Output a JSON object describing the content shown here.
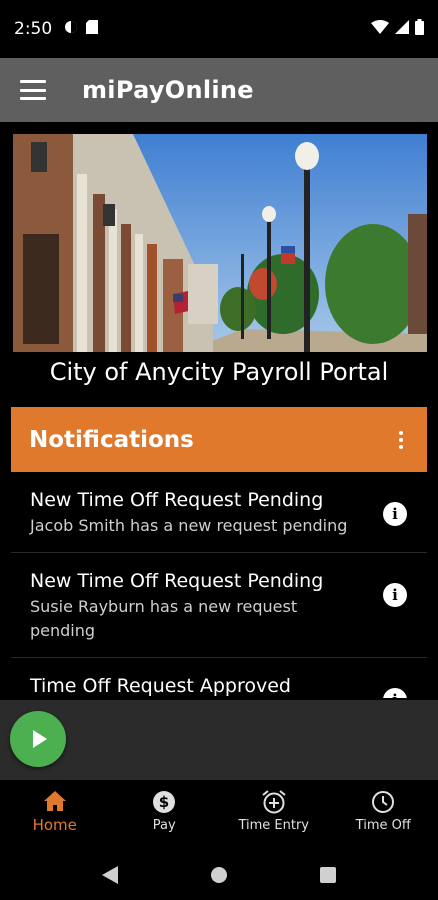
{
  "status_bar": {
    "time": "2:50"
  },
  "app_bar": {
    "title": "miPayOnline"
  },
  "portal": {
    "title": "City of Anycity Payroll Portal"
  },
  "notifications": {
    "header": "Notifications",
    "items": [
      {
        "title": "New Time Off Request Pending",
        "body": "Jacob Smith has a new request pending"
      },
      {
        "title": "New Time Off Request Pending",
        "body": "Susie Rayburn has a new request pending"
      },
      {
        "title": "Time Off Request Approved",
        "body": ""
      }
    ]
  },
  "bottom_nav": {
    "items": [
      {
        "label": "Home",
        "icon": "home-icon",
        "active": true
      },
      {
        "label": "Pay",
        "icon": "dollar-icon",
        "active": false
      },
      {
        "label": "Time Entry",
        "icon": "alarm-add-icon",
        "active": false
      },
      {
        "label": "Time Off",
        "icon": "clock-icon",
        "active": false
      }
    ]
  },
  "colors": {
    "accent": "#e1792d",
    "app_bar": "#5f5f5f",
    "fab": "#4caf50"
  }
}
